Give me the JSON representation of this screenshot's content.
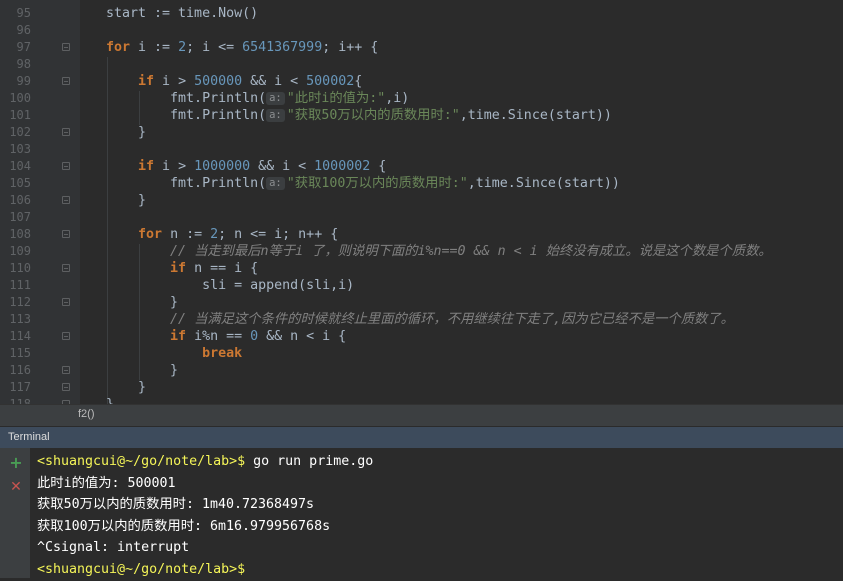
{
  "editor": {
    "lines": [
      {
        "num": "95",
        "tokens": [
          {
            "t": "start := time.Now()"
          }
        ]
      },
      {
        "num": "96",
        "tokens": []
      },
      {
        "num": "97",
        "fold": true,
        "tokens": [
          {
            "t": "for",
            "c": "kw"
          },
          {
            "t": " i := "
          },
          {
            "t": "2",
            "c": "num"
          },
          {
            "t": "; i <= "
          },
          {
            "t": "6541367999",
            "c": "num"
          },
          {
            "t": "; i++ {"
          }
        ]
      },
      {
        "num": "98",
        "tokens": []
      },
      {
        "num": "99",
        "fold": true,
        "tokens": [
          {
            "t": "    "
          },
          {
            "t": "if",
            "c": "kw"
          },
          {
            "t": " i > "
          },
          {
            "t": "500000",
            "c": "num"
          },
          {
            "t": " && i < "
          },
          {
            "t": "500002",
            "c": "num"
          },
          {
            "t": "{"
          }
        ]
      },
      {
        "num": "100",
        "tokens": [
          {
            "t": "        fmt.Println("
          },
          {
            "t": "a:",
            "c": "hint"
          },
          {
            "t": "\"此时i的值为:\"",
            "c": "str"
          },
          {
            "t": ",i)"
          }
        ]
      },
      {
        "num": "101",
        "tokens": [
          {
            "t": "        fmt.Println("
          },
          {
            "t": "a:",
            "c": "hint"
          },
          {
            "t": "\"获取50万以内的质数用时:\"",
            "c": "str"
          },
          {
            "t": ",time.Since(start))"
          }
        ]
      },
      {
        "num": "102",
        "fold": true,
        "tokens": [
          {
            "t": "    }"
          }
        ]
      },
      {
        "num": "103",
        "tokens": []
      },
      {
        "num": "104",
        "fold": true,
        "tokens": [
          {
            "t": "    "
          },
          {
            "t": "if",
            "c": "kw"
          },
          {
            "t": " i > "
          },
          {
            "t": "1000000",
            "c": "num"
          },
          {
            "t": " && i < "
          },
          {
            "t": "1000002",
            "c": "num"
          },
          {
            "t": " {"
          }
        ]
      },
      {
        "num": "105",
        "tokens": [
          {
            "t": "        fmt.Println("
          },
          {
            "t": "a:",
            "c": "hint"
          },
          {
            "t": "\"获取100万以内的质数用时:\"",
            "c": "str"
          },
          {
            "t": ",time.Since(start))"
          }
        ]
      },
      {
        "num": "106",
        "fold": true,
        "tokens": [
          {
            "t": "    }"
          }
        ]
      },
      {
        "num": "107",
        "tokens": []
      },
      {
        "num": "108",
        "fold": true,
        "tokens": [
          {
            "t": "    "
          },
          {
            "t": "for",
            "c": "kw"
          },
          {
            "t": " n := "
          },
          {
            "t": "2",
            "c": "num"
          },
          {
            "t": "; n <= i; n++ {"
          }
        ]
      },
      {
        "num": "109",
        "tokens": [
          {
            "t": "        "
          },
          {
            "t": "// 当走到最后n等于i 了，则说明下面的i%n==0 && n < i 始终没有成立。说是这个数是个质数。",
            "c": "cm"
          }
        ]
      },
      {
        "num": "110",
        "fold": true,
        "tokens": [
          {
            "t": "        "
          },
          {
            "t": "if",
            "c": "kw"
          },
          {
            "t": " n == i {"
          }
        ]
      },
      {
        "num": "111",
        "tokens": [
          {
            "t": "            sli = append(sli,i)"
          }
        ]
      },
      {
        "num": "112",
        "fold": true,
        "tokens": [
          {
            "t": "        }"
          }
        ]
      },
      {
        "num": "113",
        "tokens": [
          {
            "t": "        "
          },
          {
            "t": "// 当满足这个条件的时候就终止里面的循环，不用继续往下走了,因为它已经不是一个质数了。",
            "c": "cm"
          }
        ]
      },
      {
        "num": "114",
        "fold": true,
        "tokens": [
          {
            "t": "        "
          },
          {
            "t": "if",
            "c": "kw"
          },
          {
            "t": " i%n == "
          },
          {
            "t": "0",
            "c": "num"
          },
          {
            "t": " && n < i {"
          }
        ]
      },
      {
        "num": "115",
        "tokens": [
          {
            "t": "            "
          },
          {
            "t": "break",
            "c": "kw"
          }
        ]
      },
      {
        "num": "116",
        "fold": true,
        "tokens": [
          {
            "t": "        }"
          }
        ]
      },
      {
        "num": "117",
        "fold": true,
        "tokens": [
          {
            "t": "    }"
          }
        ]
      },
      {
        "num": "118",
        "fold": true,
        "tokens": [
          {
            "t": "}"
          }
        ]
      }
    ]
  },
  "breadcrumb": {
    "label": "f2()"
  },
  "terminal": {
    "title": "Terminal",
    "add_icon": "+",
    "close_icon": "✕",
    "lines": [
      {
        "prompt": "<shuangcui@~/go/note/lab>$",
        "text": " go run prime.go"
      },
      {
        "text": "此时i的值为: 500001"
      },
      {
        "text": "获取50万以内的质数用时: 1m40.72368497s"
      },
      {
        "text": "获取100万以内的质数用时: 6m16.979956768s"
      },
      {
        "text": "^Csignal: interrupt"
      },
      {
        "prompt": "<shuangcui@~/go/note/lab>$",
        "text": ""
      }
    ]
  },
  "colors": {
    "background": "#2b2b2b",
    "keyword": "#cc7832",
    "number": "#6897bb",
    "string": "#6a8759",
    "comment": "#808080",
    "prompt": "#f5f558",
    "terminal_header": "#3d4b5c",
    "add_green": "#499c54",
    "close_red": "#c75450"
  }
}
